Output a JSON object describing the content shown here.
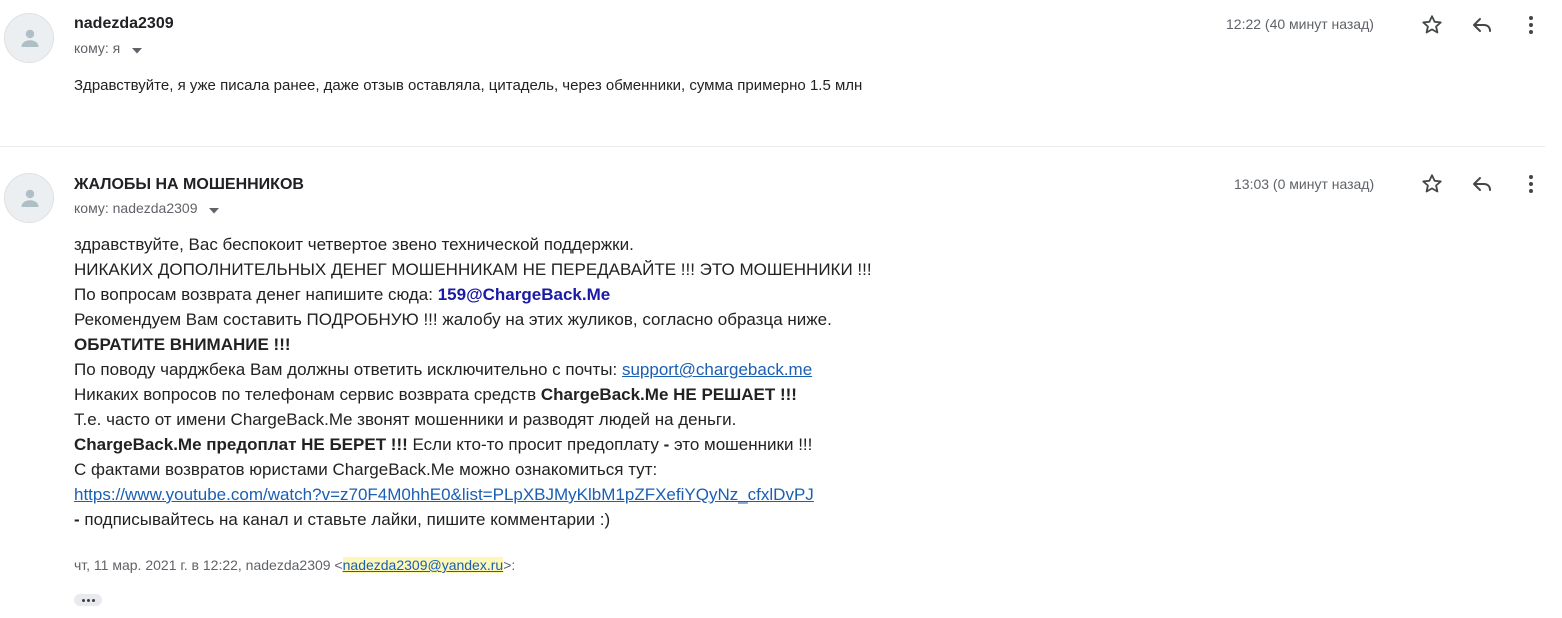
{
  "messages": [
    {
      "sender": "nadezda2309",
      "to": "кому: я",
      "time": "12:22 (40 минут назад)",
      "body": [
        "Здравствуйте,  я уже писала ранее, даже отзыв оставляла, цитадель,  через обменники, сумма примерно 1.5 млн"
      ]
    },
    {
      "sender": "ЖАЛОБЫ НА МОШЕННИКОВ",
      "to": "кому: nadezda2309",
      "time": "13:03 (0 минут назад)",
      "body": {
        "l1": "здравствуйте, Вас беспокоит четвертое звено технической поддержки.",
        "l2": "НИКАКИХ ДОПОЛНИТЕЛЬНЫХ ДЕНЕГ МОШЕННИКАМ НЕ ПЕРЕДАВАЙТЕ !!! ЭТО МОШЕННИКИ !!!",
        "l3_text": "По вопросам возврата денег напишите сюда: ",
        "l3_email": "159@ChargeBack.Me",
        "l4": "Рекомендуем Вам составить ПОДРОБНУЮ !!! жалобу на этих жуликов, согласно образца ниже.",
        "l5": "ОБРАТИТЕ ВНИМАНИЕ !!!",
        "l6_text": "По поводу чарджбека Вам должны ответить исключительно с почты: ",
        "l6_link": "support@chargeback.me",
        "l7_text": "Никаких вопросов по телефонам сервис возврата средств ",
        "l7_bold": "ChargeBack.Me НЕ РЕШАЕТ !!!",
        "l8": "Т.е. часто от имени ChargeBack.Me звонят мошенники и разводят людей на деньги.",
        "l9_bold": "ChargeBack.Me предоплат НЕ БЕРЕТ !!!",
        "l9_text1": " Если кто-то просит предоплату ",
        "l9_dash": "-",
        "l9_text2": " это мошенники !!!",
        "l10": "С фактами возвратов юристами ChargeBack.Me можно ознакомиться тут:",
        "l11_link": "https://www.youtube.com/watch?v=z70F4M0hhE0&list=PLpXBJMyKlbM1pZFXefiYQyNz_cfxlDvPJ",
        "l12_dash": " -",
        "l12_text": " подписывайтесь на канал и ставьте лайки, пишите комментарии :)"
      },
      "quote_prefix": "чт, 11 мар. 2021 г. в 12:22, nadezda2309 <",
      "quote_email": "nadezda2309@yandex.ru",
      "quote_suffix": ">:"
    }
  ],
  "icons": [
    "person-icon",
    "star-icon",
    "reply-icon",
    "more-vert-icon",
    "caret-down-icon",
    "ellipsis-icon"
  ]
}
